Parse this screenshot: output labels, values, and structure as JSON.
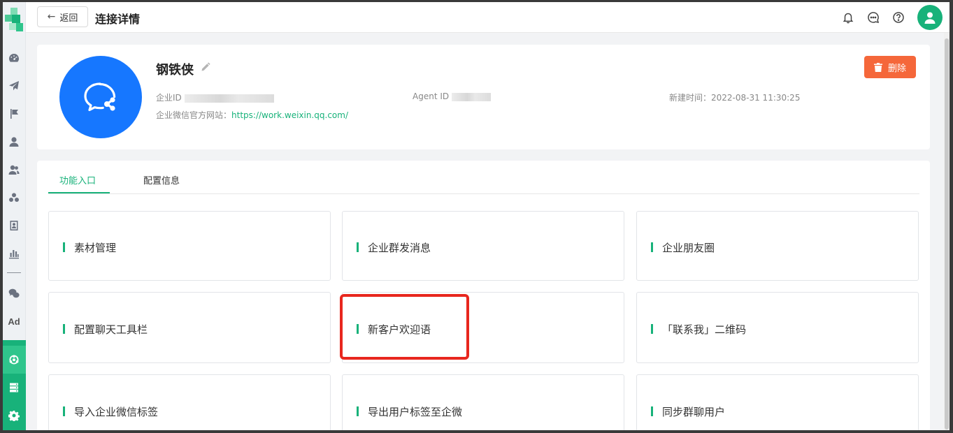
{
  "topbar": {
    "back_label": "返回",
    "title": "连接详情"
  },
  "profile": {
    "name": "钢铁侠",
    "corp_id_label": "企业ID",
    "agent_id_label": "Agent ID",
    "created_label": "新建时间：2022-08-31 11:30:25",
    "site_label": "企业微信官方网站：",
    "site_url": "https://work.weixin.qq.com/",
    "delete_label": "删除"
  },
  "tabs": [
    "功能入口",
    "配置信息"
  ],
  "feature_cards": [
    "素材管理",
    "企业群发消息",
    "企业朋友圈",
    "配置聊天工具栏",
    "新客户欢迎语",
    "「联系我」二维码",
    "导入企业微信标签",
    "导出用户标签至企微",
    "同步群聊用户"
  ],
  "colors": {
    "accent": "#18b27a",
    "delete": "#f5673a",
    "avatar_blue": "#1677ff",
    "highlight": "#e8271e"
  },
  "icons": {
    "sidebar": [
      "dashboard-icon",
      "send-icon",
      "flag-icon",
      "user-icon",
      "users-icon",
      "group-icon",
      "contact-book-icon",
      "bar-chart-icon",
      "wechat-icon",
      "ad-icon",
      "connection-icon",
      "server-icon",
      "settings-icon"
    ],
    "top": [
      "bell-icon",
      "chat-icon",
      "help-icon",
      "user-avatar-icon"
    ]
  },
  "sidebar_ad_label": "Ad"
}
